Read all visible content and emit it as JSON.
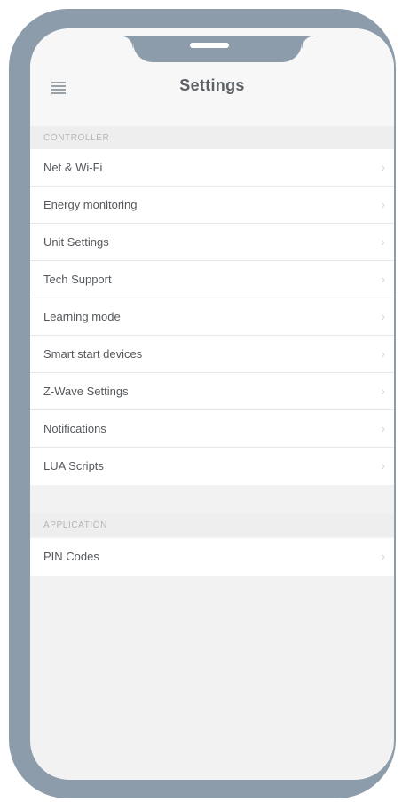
{
  "header": {
    "title": "Settings",
    "menu_icon": "hamburger-menu-icon"
  },
  "sections": [
    {
      "title": "CONTROLLER",
      "items": [
        {
          "label": "Net & Wi-Fi"
        },
        {
          "label": "Energy monitoring"
        },
        {
          "label": "Unit Settings"
        },
        {
          "label": "Tech Support"
        },
        {
          "label": "Learning mode"
        },
        {
          "label": "Smart start devices"
        },
        {
          "label": "Z-Wave Settings"
        },
        {
          "label": "Notifications"
        },
        {
          "label": "LUA Scripts"
        }
      ]
    },
    {
      "title": "APPLICATION",
      "items": [
        {
          "label": "PIN Codes"
        }
      ]
    }
  ],
  "chevron_glyph": "›",
  "colors": {
    "phone_frame": "#8c9cab",
    "screen_background": "#f2f2f2",
    "text": "#55595d"
  }
}
